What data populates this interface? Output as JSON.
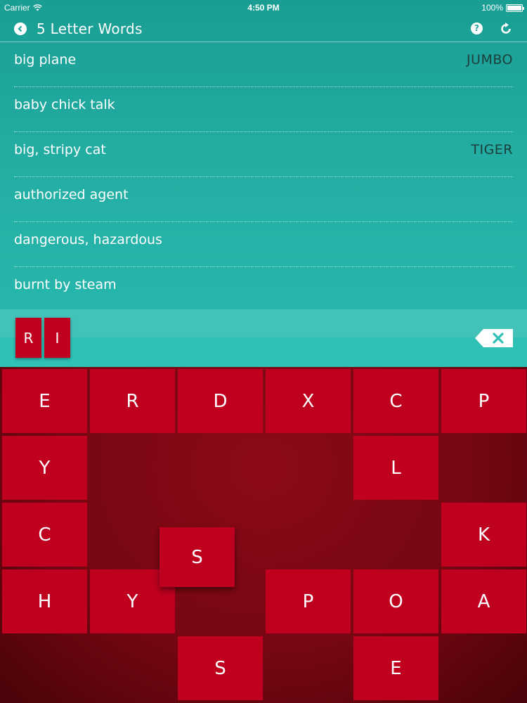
{
  "status": {
    "carrier": "Carrier",
    "time": "4:50 PM",
    "battery": "100%"
  },
  "nav": {
    "title": "5 Letter Words",
    "help": "?"
  },
  "clues": [
    {
      "text": "big plane",
      "answer": "JUMBO"
    },
    {
      "text": "baby chick talk",
      "answer": ""
    },
    {
      "text": "big, stripy cat",
      "answer": "TIGER"
    },
    {
      "text": "authorized agent",
      "answer": ""
    },
    {
      "text": "dangerous, hazardous",
      "answer": ""
    },
    {
      "text": "burnt by steam",
      "answer": ""
    }
  ],
  "typed": [
    "R",
    "I"
  ],
  "board": {
    "rows": [
      [
        "E",
        "R",
        "D",
        "X",
        "C",
        "P"
      ],
      [
        "Y",
        "",
        "",
        "",
        "L",
        ""
      ],
      [
        "C",
        "",
        "",
        "",
        "",
        "K"
      ],
      [
        "H",
        "Y",
        "",
        "P",
        "O",
        "A"
      ],
      [
        "",
        "",
        "S",
        "",
        "E",
        ""
      ]
    ],
    "floating": "S"
  },
  "colors": {
    "teal": "#23aea4",
    "tile_red": "#c0001f",
    "board_red": "#7a0714",
    "answer_text": "#1c3f3c"
  }
}
